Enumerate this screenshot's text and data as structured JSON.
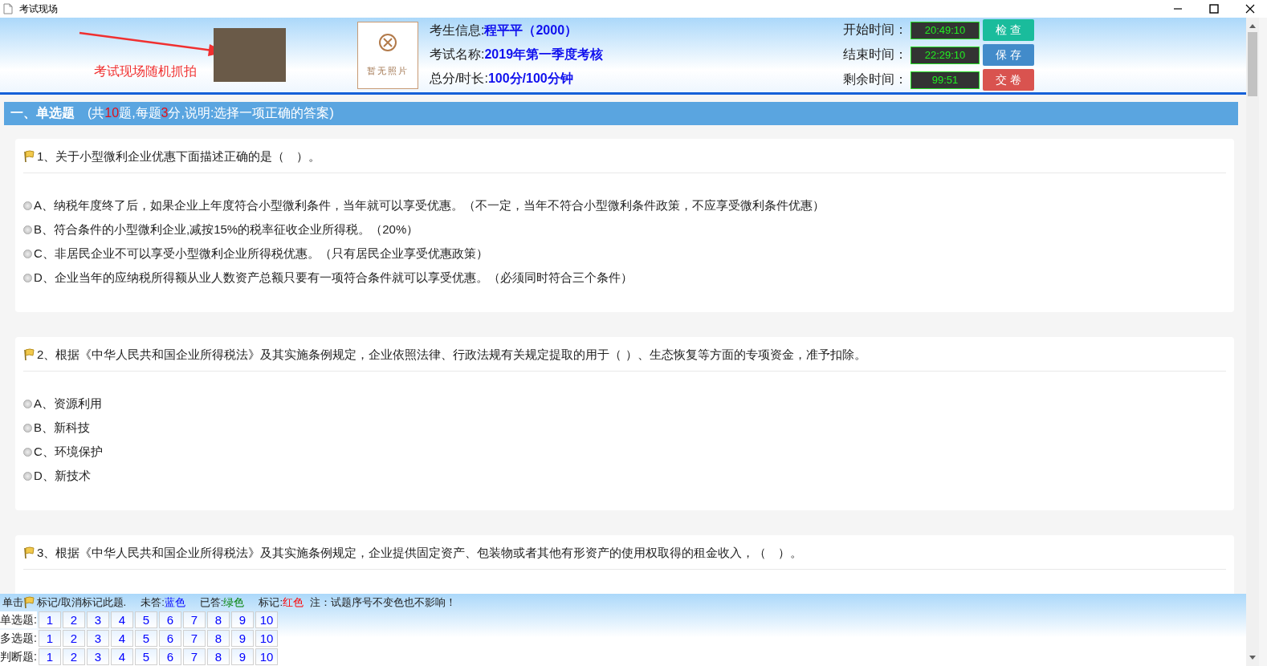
{
  "window": {
    "title": "考试现场"
  },
  "header": {
    "snapshot_caption": "考试现场随机抓拍",
    "no_photo_label": "暂无照片",
    "exam_info": [
      {
        "label": "考生信息:",
        "value": "程平平（2000）"
      },
      {
        "label": "考试名称:",
        "value": "2019年第一季度考核"
      },
      {
        "label": "总分/时长:",
        "value": "100分/100分钟"
      }
    ],
    "times": [
      {
        "label": "开始时间：",
        "value": "20:49:10"
      },
      {
        "label": "结束时间：",
        "value": "22:29:10"
      },
      {
        "label": "剩余时间：",
        "value": "99:51"
      }
    ],
    "buttons": [
      {
        "label": "检 查",
        "kind": "check"
      },
      {
        "label": "保 存",
        "kind": "save"
      },
      {
        "label": "交 卷",
        "kind": "submit"
      }
    ]
  },
  "section": {
    "title": "一、单选题",
    "description": [
      {
        "text": "(共",
        "kind": "plain"
      },
      {
        "text": "10",
        "kind": "number"
      },
      {
        "text": "题,每题",
        "kind": "plain"
      },
      {
        "text": "3",
        "kind": "number"
      },
      {
        "text": "分,说明:选择一项正确的答案)",
        "kind": "plain"
      }
    ]
  },
  "questions": [
    {
      "title": "1、关于小型微利企业优惠下面描述正确的是（　）。",
      "options": [
        {
          "label": "A、纳税年度终了后，如果企业上年度符合小型微利条件，当年就可以享受优惠。（不一定，当年不符合小型微利条件政策，不应享受微利条件优惠）",
          "selected": false
        },
        {
          "label": "B、符合条件的小型微利企业,减按15%的税率征收企业所得税。（20%）",
          "selected": false
        },
        {
          "label": "C、非居民企业不可以享受小型微利企业所得税优惠。（只有居民企业享受优惠政策）",
          "selected": false
        },
        {
          "label": "D、企业当年的应纳税所得额从业人数资产总额只要有一项符合条件就可以享受优惠。（必须同时符合三个条件）",
          "selected": false
        }
      ]
    },
    {
      "title": "2、根据《中华人民共和国企业所得税法》及其实施条例规定，企业依照法律、行政法规有关规定提取的用于（ ）、生态恢复等方面的专项资金，准予扣除。",
      "options": [
        {
          "label": "A、资源利用",
          "selected": false
        },
        {
          "label": "B、新科技",
          "selected": false
        },
        {
          "label": "C、环境保护",
          "selected": false
        },
        {
          "label": "D、新技术",
          "selected": false
        }
      ]
    },
    {
      "title": "3、根据《中华人民共和国企业所得税法》及其实施条例规定，企业提供固定资产、包装物或者其他有形资产的使用权取得的租金收入，（　）。"
    }
  ],
  "footer": {
    "hint_before": "单击",
    "hint_after": "标记/取消标记此题.",
    "legend": [
      {
        "label": "未答:",
        "value": "蓝色",
        "kind": "unanswered"
      },
      {
        "label": "已答:",
        "value": "绿色",
        "kind": "answered"
      },
      {
        "label": "标记:",
        "value": "红色",
        "kind": "marked"
      }
    ],
    "note": "注：试题序号不变色也不影响！",
    "rows": [
      {
        "label": "单选题:",
        "items": [
          "1",
          "2",
          "3",
          "4",
          "5",
          "6",
          "7",
          "8",
          "9",
          "10"
        ]
      },
      {
        "label": "多选题:",
        "items": [
          "1",
          "2",
          "3",
          "4",
          "5",
          "6",
          "7",
          "8",
          "9",
          "10"
        ]
      },
      {
        "label": "判断题:",
        "items": [
          "1",
          "2",
          "3",
          "4",
          "5",
          "6",
          "7",
          "8",
          "9",
          "10"
        ]
      }
    ]
  }
}
